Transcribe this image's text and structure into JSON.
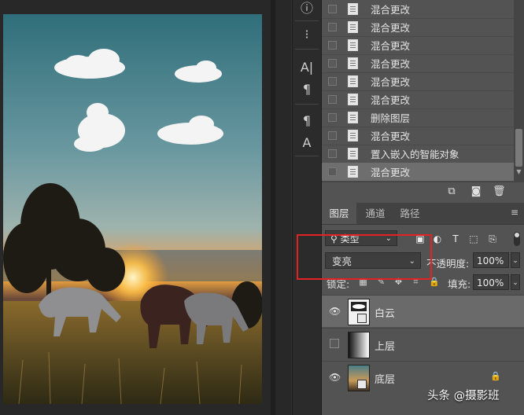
{
  "history": {
    "items": [
      {
        "label": "混合更改",
        "selected": false
      },
      {
        "label": "混合更改",
        "selected": false
      },
      {
        "label": "混合更改",
        "selected": false
      },
      {
        "label": "混合更改",
        "selected": false
      },
      {
        "label": "混合更改",
        "selected": false
      },
      {
        "label": "混合更改",
        "selected": false
      },
      {
        "label": "删除图层",
        "selected": false
      },
      {
        "label": "混合更改",
        "selected": false
      },
      {
        "label": "置入嵌入的智能对象",
        "selected": false
      },
      {
        "label": "混合更改",
        "selected": true
      }
    ]
  },
  "toolbar_icons": [
    "info-icon",
    "brush-preset-icon",
    "character-icon",
    "paragraph-icon",
    "paragraph-style-icon",
    "character-style-icon"
  ],
  "layers_panel": {
    "tabs": [
      "图层",
      "通道",
      "路径"
    ],
    "active_tab": "图层",
    "filter": {
      "value": "类型"
    },
    "blend_mode": {
      "value": "变亮"
    },
    "opacity": {
      "label": "不透明度:",
      "value": "100%"
    },
    "lock": {
      "label": "锁定:"
    },
    "fill": {
      "label": "填充:",
      "value": "100%"
    },
    "layers": [
      {
        "name": "白云",
        "visible": true,
        "selected": true,
        "locked": false
      },
      {
        "name": "上层",
        "visible": false,
        "selected": false,
        "locked": false
      },
      {
        "name": "底层",
        "visible": true,
        "selected": false,
        "locked": true
      }
    ]
  },
  "watermark": "头条 @摄影班",
  "colors": {
    "highlight": "#e02424",
    "panel": "#535353"
  }
}
